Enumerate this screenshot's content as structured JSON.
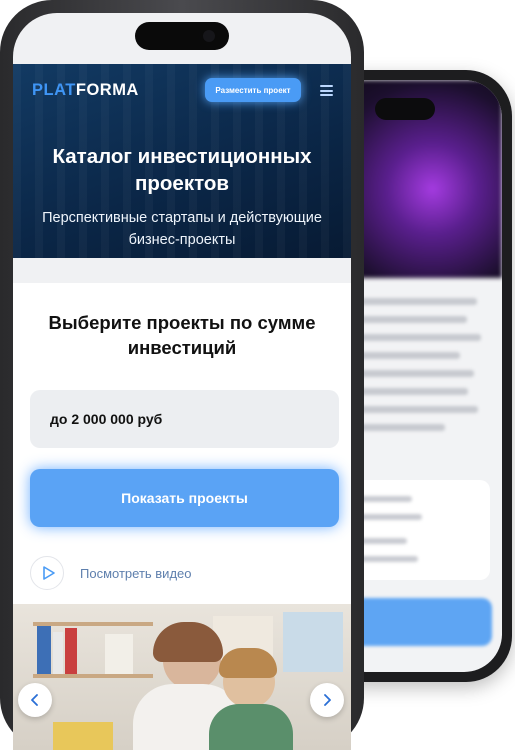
{
  "header": {
    "logo_part1": "PLAT",
    "logo_part2": "FORMA",
    "cta_label": "Разместить проект",
    "menu_icon": "hamburger-icon"
  },
  "hero": {
    "title": "Каталог инвестиционных проектов",
    "subtitle": "Перспективные стартапы и действующие бизнес-проекты"
  },
  "filter": {
    "title": "Выберите проекты по сумме инвестиций",
    "amount_value": "до 2 000 000 руб",
    "submit_label": "Показать проекты"
  },
  "video": {
    "label": "Посмотреть видео",
    "icon": "play-icon"
  },
  "slider": {
    "prev_icon": "chevron-left-icon",
    "next_icon": "chevron-right-icon"
  },
  "colors": {
    "accent": "#4a9bf5",
    "hero_bg": "#0b2748",
    "logo_accent": "#3f95f5"
  }
}
